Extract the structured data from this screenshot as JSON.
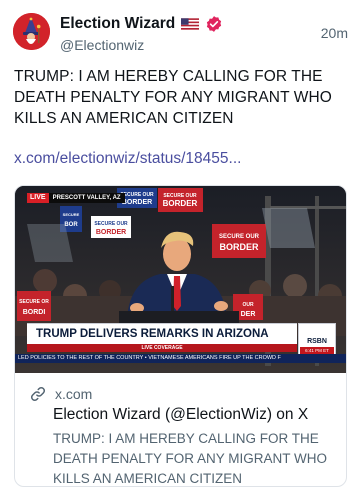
{
  "account": {
    "name": "Election Wizard",
    "handle": "@Electionwiz",
    "avatar_icon": "wizard-avatar-icon",
    "flag_icon": "us-flag-icon",
    "verified_icon": "verified-badge-icon",
    "badge_color": "#e0245e"
  },
  "post": {
    "time": "20m",
    "text": "TRUMP: I AM HEREBY CALLING FOR THE DEATH PENALTY FOR ANY MIGRANT WHO KILLS AN AMERICAN CITIZEN",
    "link": "x.com/electionwiz/status/18455..."
  },
  "media": {
    "live_label": "LIVE",
    "location": "PRESCOTT VALLEY, AZ",
    "headline": "TRUMP DELIVERS REMARKS IN ARIZONA",
    "coverage": "LIVE COVERAGE",
    "network": "RSBN",
    "clock": "6:41 PM ET",
    "ticker": "LED POLICIES TO THE REST OF THE COUNTRY   •   VIETNAMESE AMERICANS FIRE UP THE CROWD F",
    "sign_text": [
      "SECURE OUR",
      "BORDER"
    ]
  },
  "card": {
    "domain_icon": "link-icon",
    "domain": "x.com",
    "title": "Election Wizard (@ElectionWiz) on X",
    "description": "TRUMP: I AM HEREBY CALLING FOR THE DEATH PENALTY FOR ANY MIGRANT WHO KILLS AN AMERICAN CITIZEN"
  }
}
